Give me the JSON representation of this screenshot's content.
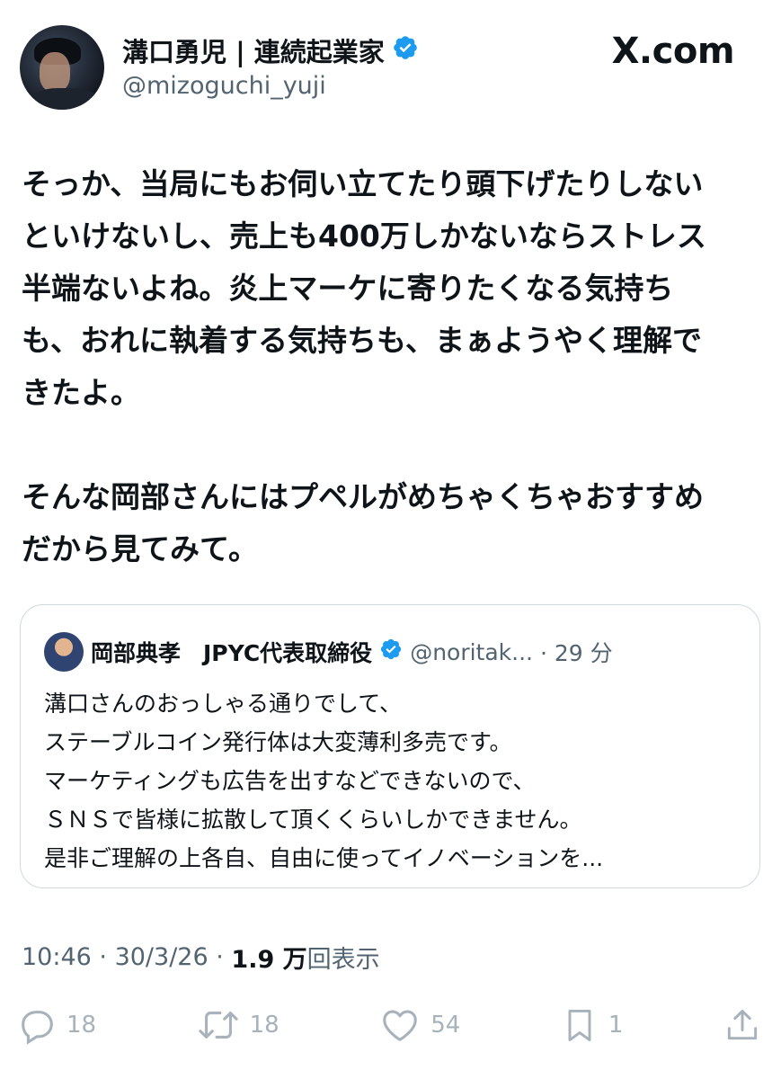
{
  "author": {
    "display_name": "溝口勇児 | 連続起業家",
    "handle": "@mizoguchi_yuji",
    "verified": true
  },
  "brand": "X.com",
  "tweet": {
    "paragraphs": [
      [
        "そっか、当局にもお伺い立てたり頭下げたりしない",
        "といけないし、売上も400万しかないならストレス",
        "半端ないよね。炎上マーケに寄りたくなる気持ち",
        "も、おれに執着する気持ちも、まぁようやく理解で",
        "きたよ。"
      ],
      [
        "そんな岡部さんにはプペルがめちゃくちゃおすすめ",
        "だから見てみて。"
      ]
    ]
  },
  "quoted_tweet": {
    "display_name": "岡部典孝　JPYC代表取締役",
    "handle": "@noritak...",
    "time": "· 29 分",
    "lines": [
      "溝口さんのおっしゃる通りでして、",
      "ステーブルコイン発行体は大変薄利多売です。",
      "マーケティングも広告を出すなどできないので、",
      "ＳＮＳで皆様に拡散して頂くくらいしかできません。",
      "是非ご理解の上各自、自由に使ってイノベーションを..."
    ]
  },
  "meta": {
    "time": "10:46",
    "date": "30/3/26",
    "views_count": "1.9 万",
    "views_label": "回表示"
  },
  "actions": {
    "replies": "18",
    "reposts": "18",
    "likes": "54",
    "bookmarks": "1"
  },
  "colors": {
    "text": "#0f1419",
    "secondary": "#536471",
    "verified_blue": "#1d9bf0",
    "border": "#cfd9de",
    "action_grey": "#a7b2bb"
  },
  "icons": [
    "verified-badge-icon",
    "reply-icon",
    "repost-icon",
    "like-icon",
    "bookmark-icon",
    "share-icon"
  ]
}
